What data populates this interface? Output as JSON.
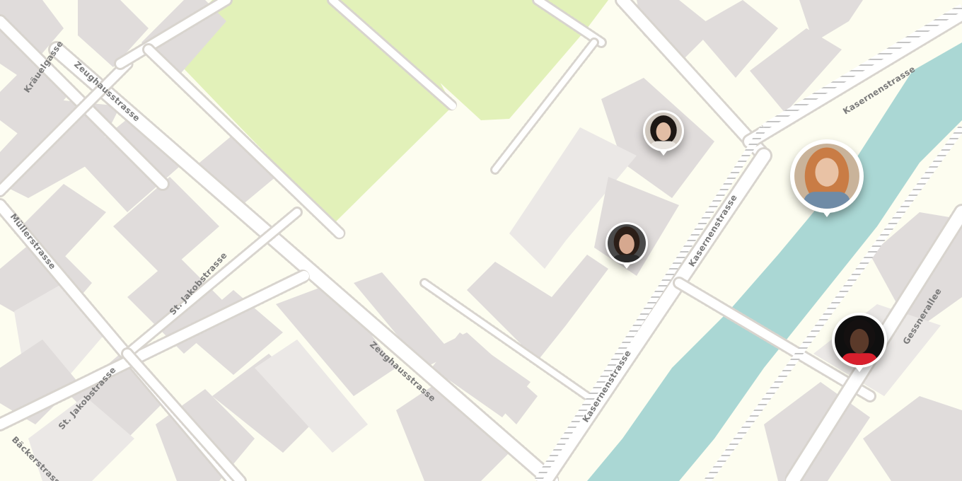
{
  "map": {
    "colors": {
      "background": "#fdfdf0",
      "park": "#e2f1b9",
      "building": "#e0dcdb",
      "building_light": "#ebe8e6",
      "water": "#aad7d4",
      "road": "#ffffff",
      "road_dots": "#d8d4ce",
      "railway": "#b9b9b9"
    },
    "street_labels": [
      {
        "text": "Kräuelgasse"
      },
      {
        "text": "Zeughausstrasse"
      },
      {
        "text": "Müllerstrasse"
      },
      {
        "text": "St. Jakobstrasse"
      },
      {
        "text": "St. Jakobstrasse"
      },
      {
        "text": "Bäckerstrasse"
      },
      {
        "text": "Zeughausstrasse"
      },
      {
        "text": "Kasernenstrasse"
      },
      {
        "text": "Kasernenstrasse"
      },
      {
        "text": "Kasernenstrasse"
      },
      {
        "text": "Gessnerallee"
      }
    ],
    "markers": [
      {
        "name": "person-marker-1",
        "bg": "#cfc7be",
        "hair": "#1d1714",
        "skin": "#e2bda5",
        "shirt": "#e8e4df"
      },
      {
        "name": "person-marker-2",
        "bg": "#c9b39a",
        "hair": "#c97c45",
        "skin": "#e9c2a5",
        "shirt": "#6f8ba6"
      },
      {
        "name": "person-marker-3",
        "bg": "#4a4a4a",
        "hair": "#2b1e17",
        "skin": "#d6a88f",
        "shirt": "#2a2a2a"
      },
      {
        "name": "person-marker-4",
        "bg": "#0f0f0f",
        "hair": "#141010",
        "skin": "#5b3a2a",
        "shirt": "#d81f2d"
      }
    ]
  }
}
